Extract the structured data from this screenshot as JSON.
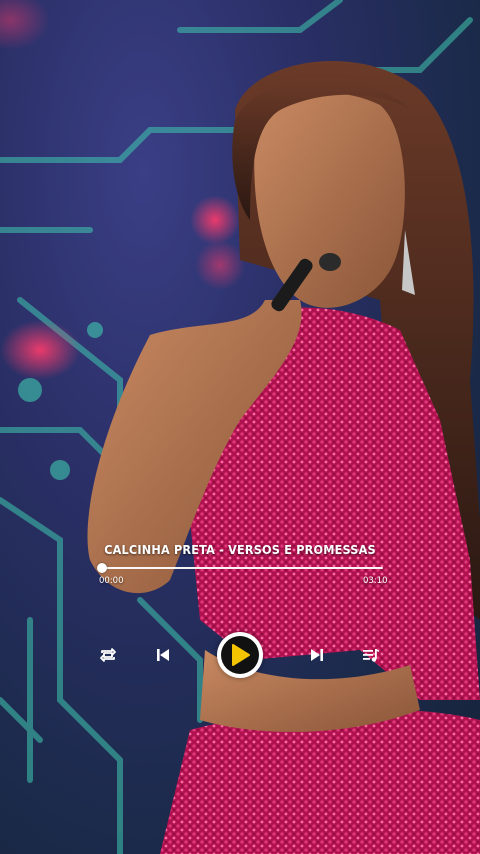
{
  "player": {
    "title": "CALCINHA PRETA - VERSOS E PROMESSAS",
    "current_time": "00:00",
    "duration": "03:10",
    "progress": 0.0,
    "accent_color": "#F5C400",
    "controls": {
      "repeat_icon": "repeat-icon",
      "previous_icon": "skip-previous-icon",
      "play_icon": "play-icon",
      "next_icon": "skip-next-icon",
      "playlist_icon": "playlist-icon"
    }
  },
  "background": {
    "scene": "concert-stage",
    "dress_color": "#C2185B"
  }
}
